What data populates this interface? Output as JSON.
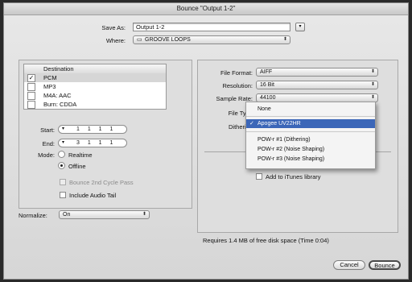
{
  "window": {
    "title": "Bounce \"Output 1-2\""
  },
  "save_as": {
    "label": "Save As:",
    "value": "Output 1-2"
  },
  "where": {
    "label": "Where:",
    "value": "GROOVE LOOPS"
  },
  "destination": {
    "header": "Destination",
    "rows": [
      {
        "label": "PCM",
        "checked": true
      },
      {
        "label": "MP3",
        "checked": false
      },
      {
        "label": "M4A: AAC",
        "checked": false
      },
      {
        "label": "Burn: CDDA",
        "checked": false
      }
    ]
  },
  "start": {
    "label": "Start:",
    "value": "1  1  1  1"
  },
  "end": {
    "label": "End:",
    "value": "3  1  1  1"
  },
  "mode": {
    "label": "Mode:",
    "realtime": "Realtime",
    "offline": "Offline"
  },
  "options": {
    "bounce_cycle": "Bounce 2nd Cycle Pass",
    "audio_tail": "Include Audio Tail"
  },
  "normalize": {
    "label": "Normalize:",
    "value": "On"
  },
  "format": {
    "file_format_label": "File Format:",
    "file_format": "AIFF",
    "resolution_label": "Resolution:",
    "resolution": "16 Bit",
    "sample_rate_label": "Sample Rate:",
    "sample_rate": "44100",
    "file_type_label": "File Type",
    "dithering_label": "Dithering"
  },
  "dither_menu": {
    "none": "None",
    "selected": "Apogee UV22HR",
    "items": [
      "POW-r #1 (Dithering)",
      "POW-r #2 (Noise Shaping)",
      "POW-r #3 (Noise Shaping)"
    ]
  },
  "itunes": {
    "label": "Add to iTunes library"
  },
  "requirement": "Requires 1.4 MB of free disk space  (Time 0:04)",
  "buttons": {
    "cancel": "Cancel",
    "bounce": "Bounce"
  }
}
